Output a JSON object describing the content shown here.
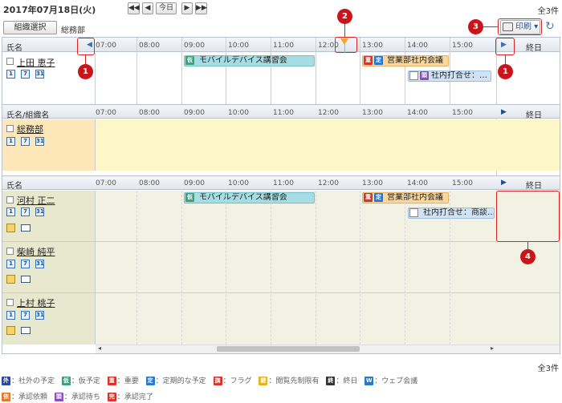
{
  "header": {
    "date": "2017年07月18日(火)",
    "nav": {
      "prev_week": "◀◀",
      "prev_day": "◀",
      "today": "今日",
      "next_day": "▶",
      "next_week": "▶▶"
    },
    "count": "全3件"
  },
  "toolbar": {
    "org_select_label": "組織選択",
    "org_name": "総務部",
    "print_label": "印刷"
  },
  "timeline": {
    "ticks": [
      "07:00",
      "08:00",
      "09:00",
      "10:00",
      "11:00",
      "12:00",
      "13:00",
      "14:00",
      "15:00"
    ],
    "end_label": "終日"
  },
  "section1": {
    "name_header": "氏名",
    "user": "上田 恵子",
    "events": [
      {
        "badge": "仮",
        "title": "モバイルデバイス講習会"
      },
      {
        "badge": "重",
        "badge2": "定",
        "title": "営業部社内会議"
      },
      {
        "badge": "頭",
        "title": "社内打合せ：…"
      }
    ]
  },
  "section2": {
    "name_header": "氏名/組織名",
    "org": "総務部",
    "end_label": "終日"
  },
  "section3": {
    "name_header": "氏名",
    "end_label": "終日",
    "users": [
      {
        "name": "河村 正二",
        "events": [
          {
            "badge": "仮",
            "title": "モバイルデバイス講習会"
          },
          {
            "badge": "重",
            "badge2": "定",
            "title": "営業部社内会議"
          },
          {
            "title": "社内打合せ：商談…"
          }
        ]
      },
      {
        "name": "柴崎 純平"
      },
      {
        "name": "上村 桃子"
      }
    ]
  },
  "markers": [
    "1",
    "2",
    "3",
    "1",
    "4"
  ],
  "footer": {
    "count": "全3件",
    "legend1": [
      {
        "badge": "外",
        "text": "：社外の予定"
      },
      {
        "badge": "仮",
        "text": "：仮予定"
      },
      {
        "badge": "重",
        "text": "：重要"
      },
      {
        "badge": "定",
        "text": "：定期的な予定"
      },
      {
        "badge": "旗",
        "text": "：フラグ"
      },
      {
        "badge": "鍵",
        "text": "：閲覧先制限有"
      },
      {
        "badge": "終",
        "text": "：終日"
      },
      {
        "badge": "W",
        "text": "：ウェブ会議"
      }
    ],
    "legend2": [
      {
        "badge": "依",
        "text": "：承認依頼"
      },
      {
        "badge": "頭",
        "text": "：承認待ち"
      },
      {
        "badge": "完",
        "text": "：承認完了"
      }
    ]
  },
  "colors": {
    "accent": "#c9141c",
    "header_bg": "#e3e7ed",
    "org_row_bg": "#fdf7c8",
    "user_row_bg": "#eeeed9"
  }
}
